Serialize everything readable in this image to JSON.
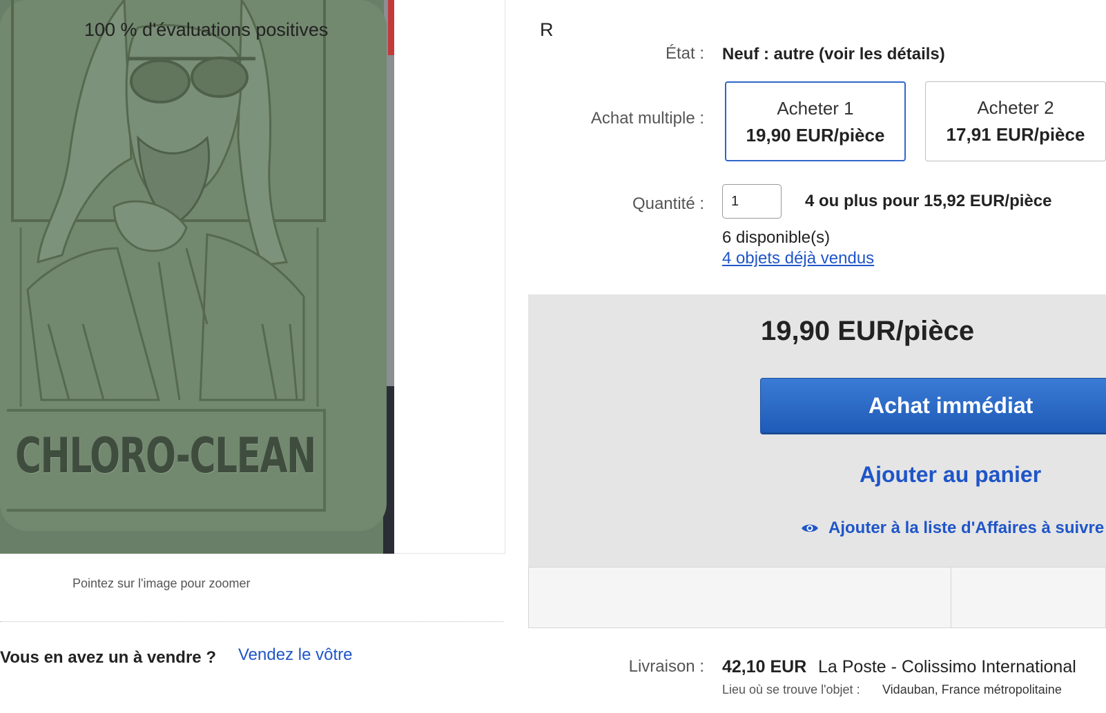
{
  "gallery": {
    "product_brand_text": "CHLORO-CLEAN",
    "zoom_hint": "Pointez sur l'image pour zoomer"
  },
  "sell": {
    "question": "Vous en avez un à vendre ?",
    "link": "Vendez le vôtre"
  },
  "details": {
    "condition_label": "État :",
    "condition_value": "Neuf : autre (voir les détails)",
    "multi_label": "Achat multiple :",
    "multi_options": [
      {
        "title": "Acheter 1",
        "price": "19,90 EUR/pièce",
        "selected": true
      },
      {
        "title": "Acheter 2",
        "price": "17,91 EUR/pièce",
        "selected": false
      }
    ],
    "qty_label": "Quantité :",
    "qty_value": "1",
    "bulk_offer": "4 ou plus pour 15,92 EUR/pièce",
    "available": "6 disponible(s)",
    "sold": "4 objets déjà vendus"
  },
  "buybox": {
    "price": "19,90 EUR/pièce",
    "buy_now": "Achat immédiat",
    "add_to_cart": "Ajouter au panier",
    "watch": "Ajouter à la liste d'Affaires à suivre",
    "positive_feedback": "100 % d'évaluations positives",
    "second_stat": "R"
  },
  "shipping": {
    "label": "Livraison :",
    "price": "42,10 EUR",
    "carrier": "La Poste - Colissimo International",
    "location_label": "Lieu où se trouve l'objet :",
    "location_value": "Vidauban, France métropolitaine"
  },
  "colors": {
    "link": "#1f55c8",
    "buy_button": "#2a66c4",
    "panel_bg": "#e5e5e5",
    "soap": "#6f846c"
  }
}
